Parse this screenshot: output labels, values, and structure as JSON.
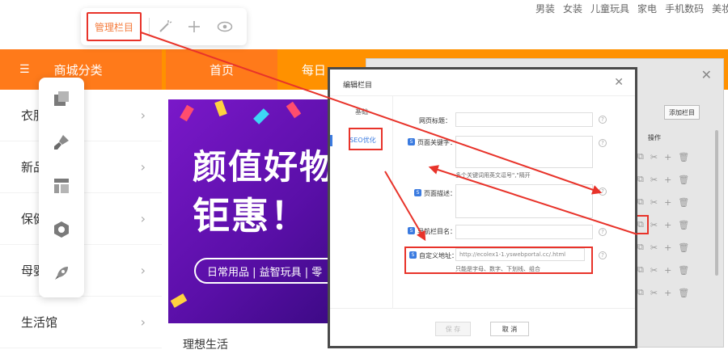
{
  "top_nav": [
    "男装",
    "女装",
    "儿童玩具",
    "家电",
    "手机数码",
    "美妆"
  ],
  "toolbar": {
    "manage_label": "管理栏目"
  },
  "category_bar": {
    "title": "商城分类",
    "tab_home": "首页",
    "tab_daily": "每日"
  },
  "categories": [
    {
      "label": "衣服"
    },
    {
      "label": "新品"
    },
    {
      "label": "保健馆"
    },
    {
      "label": "母婴"
    },
    {
      "label": "生活馆"
    }
  ],
  "banner": {
    "line1": "颜值好物",
    "line2": "钜惠！",
    "pill": "日常用品 | 益智玩具 | 零"
  },
  "below_banner": "理想生活",
  "bg_window": {
    "add_button": "添加栏目",
    "op_label": "操作"
  },
  "modal": {
    "title": "编辑栏目",
    "tab_basic": "基础",
    "tab_seo": "SEO优化",
    "labels": {
      "page_title": "网页标题：",
      "page_keywords": "页面关键字：",
      "page_desc": "页面描述：",
      "nav_name": "导航栏目名：",
      "custom_url": "自定义地址："
    },
    "keywords_hint": "多个关键词用英文逗号\",\"隔开",
    "url_value": "http://ecolex1-1.yswebportal.cc/.html",
    "url_hint": "只能是字母、数字、下划线、组合",
    "save_button": "保 存",
    "cancel_button": "取 消"
  },
  "colors": {
    "accent_orange": "#ff9100",
    "annotation_red": "#e8332a",
    "link_blue": "#3b7be0"
  }
}
